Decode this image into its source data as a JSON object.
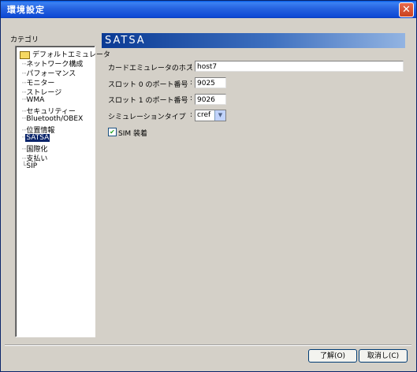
{
  "window": {
    "title": "環境設定",
    "close_glyph": "✕"
  },
  "category": {
    "label": "カテゴリ",
    "root": "デフォルトエミュレータ",
    "items": [
      "ネットワーク構成",
      "パフォーマンス",
      "モニター",
      "ストレージ",
      "WMA",
      "セキュリティー",
      "Bluetooth/OBEX",
      "位置情報",
      "SATSA",
      "国際化",
      "支払い",
      "SIP"
    ],
    "selected_index": 8
  },
  "panel": {
    "header": "SATSA",
    "host_label": "カードエミュレータのホスト名",
    "host_value": "host7",
    "slot0_label": "スロット 0 のポート番号",
    "slot0_value": "9025",
    "slot1_label": "スロット 1 のポート番号",
    "slot1_value": "9026",
    "sim_type_label": "シミュレーションタイプ",
    "sim_type_value": "cref",
    "colon": ":",
    "sim_checkbox_label": "SIM 装着",
    "sim_checked": true
  },
  "buttons": {
    "ok": "了解(O)",
    "cancel": "取消し(C)"
  }
}
